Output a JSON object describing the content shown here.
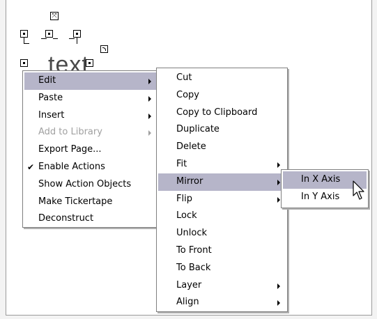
{
  "canvas": {
    "object_text": "text"
  },
  "context_menu": {
    "items": [
      {
        "label": "Edit",
        "submenu": true,
        "highlighted": true
      },
      {
        "label": "Paste",
        "submenu": true
      },
      {
        "label": "Insert",
        "submenu": true
      },
      {
        "label": "Add to Library",
        "submenu": true,
        "disabled": true
      },
      {
        "label": "Export Page..."
      },
      {
        "label": "Enable Actions",
        "checked": true
      },
      {
        "label": "Show Action Objects"
      },
      {
        "label": "Make Tickertape"
      },
      {
        "label": "Deconstruct"
      }
    ]
  },
  "edit_submenu": {
    "items": [
      {
        "label": "Cut"
      },
      {
        "label": "Copy"
      },
      {
        "label": "Copy to Clipboard"
      },
      {
        "label": "Duplicate"
      },
      {
        "label": "Delete"
      },
      {
        "label": "Fit",
        "submenu": true
      },
      {
        "label": "Mirror",
        "submenu": true,
        "highlighted": true
      },
      {
        "label": "Flip",
        "submenu": true
      },
      {
        "label": "Lock"
      },
      {
        "label": "Unlock"
      },
      {
        "label": "To Front"
      },
      {
        "label": "To Back"
      },
      {
        "label": "Layer",
        "submenu": true
      },
      {
        "label": "Align",
        "submenu": true
      }
    ]
  },
  "mirror_submenu": {
    "items": [
      {
        "label": "In X Axis",
        "highlighted": true
      },
      {
        "label": "In Y Axis"
      }
    ]
  },
  "colors": {
    "highlight": "#b6b5c9",
    "disabled_text": "#a0a0a0"
  }
}
